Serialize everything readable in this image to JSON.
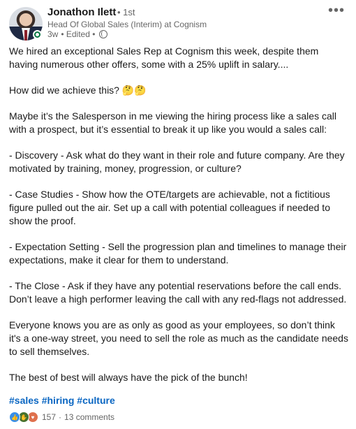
{
  "author": {
    "name": "Jonathon Ilett",
    "degree": "• 1st",
    "headline": "Head Of Global Sales (Interim) at Cognism",
    "time": "3w",
    "edited": "• Edited •"
  },
  "post": {
    "paragraphs": [
      "We hired an exceptional Sales Rep at Cognism this week, despite them having numerous other offers, some with a 25% uplift in salary....",
      "How did we achieve this? 🤔🤔",
      "Maybe it’s the Salesperson in me viewing the hiring process like a sales call with a prospect, but it’s essential to break it up like you would a sales call:",
      "- Discovery - Ask what do they want in their role and future company. Are they motivated by training, money, progression, or culture?",
      "- Case Studies - Show how the OTE/targets are achievable, not a fictitious figure pulled out the air. Set up a call with potential colleagues if needed to show the proof.",
      "- Expectation Setting - Sell the progression plan and timelines to manage their expectations, make it clear for them to understand.",
      "- The Close - Ask if they have any potential reservations before the call ends. Don’t leave a high performer leaving the call with any red-flags not addressed.",
      "Everyone knows you are as only as good as your employees, so don’t think it's a one-way street, you need to sell the role as much as the candidate needs to sell themselves.",
      "The best of best will always have the pick of the bunch!"
    ],
    "hashtags": [
      "#sales",
      "#hiring",
      "#culture"
    ]
  },
  "social": {
    "reactions": [
      "like-icon",
      "celebrate-icon",
      "love-icon"
    ],
    "reaction_count": "157",
    "separator": "·",
    "comments": "13 comments"
  },
  "colors": {
    "link": "#0a66c2",
    "like": "#378fe9",
    "celebrate": "#44712e",
    "love": "#df704d",
    "presence": "#057642"
  }
}
